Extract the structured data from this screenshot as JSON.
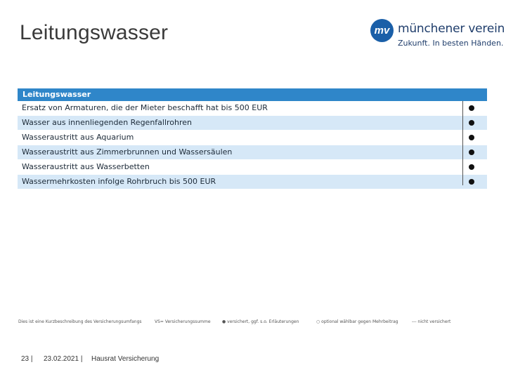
{
  "page": {
    "title": "Leitungswasser"
  },
  "logo": {
    "mark": "mv",
    "name": "münchener verein",
    "tagline": "Zukunft. In besten Händen."
  },
  "table": {
    "header": "Leitungswasser",
    "rows": [
      {
        "label": "Ersatz von Armaturen, die der Mieter beschafft hat bis 500 EUR",
        "status": "included"
      },
      {
        "label": "Wasser aus innenliegenden Regenfallrohren",
        "status": "included"
      },
      {
        "label": "Wasseraustritt aus Aquarium",
        "status": "included"
      },
      {
        "label": "Wasseraustritt aus Zimmerbrunnen und Wassersäulen",
        "status": "included"
      },
      {
        "label": "Wasseraustritt aus Wasserbetten",
        "status": "included"
      },
      {
        "label": "Wassermehrkosten infolge Rohrbruch bis 500 EUR",
        "status": "included"
      }
    ]
  },
  "legend": {
    "note": "Dies ist eine Kurzbeschreibung des Versicherungsumfangs",
    "vs": "VS= Versicherungssumme",
    "included": "● versichert, ggf. s.o. Erläuterungen",
    "optional": "○ optional wählbar gegen Mehrbeitrag",
    "excluded": "--- nicht versichert"
  },
  "footer": {
    "page": "23 |",
    "date": "23.02.2021 |",
    "product": "Hausrat Versicherung"
  }
}
